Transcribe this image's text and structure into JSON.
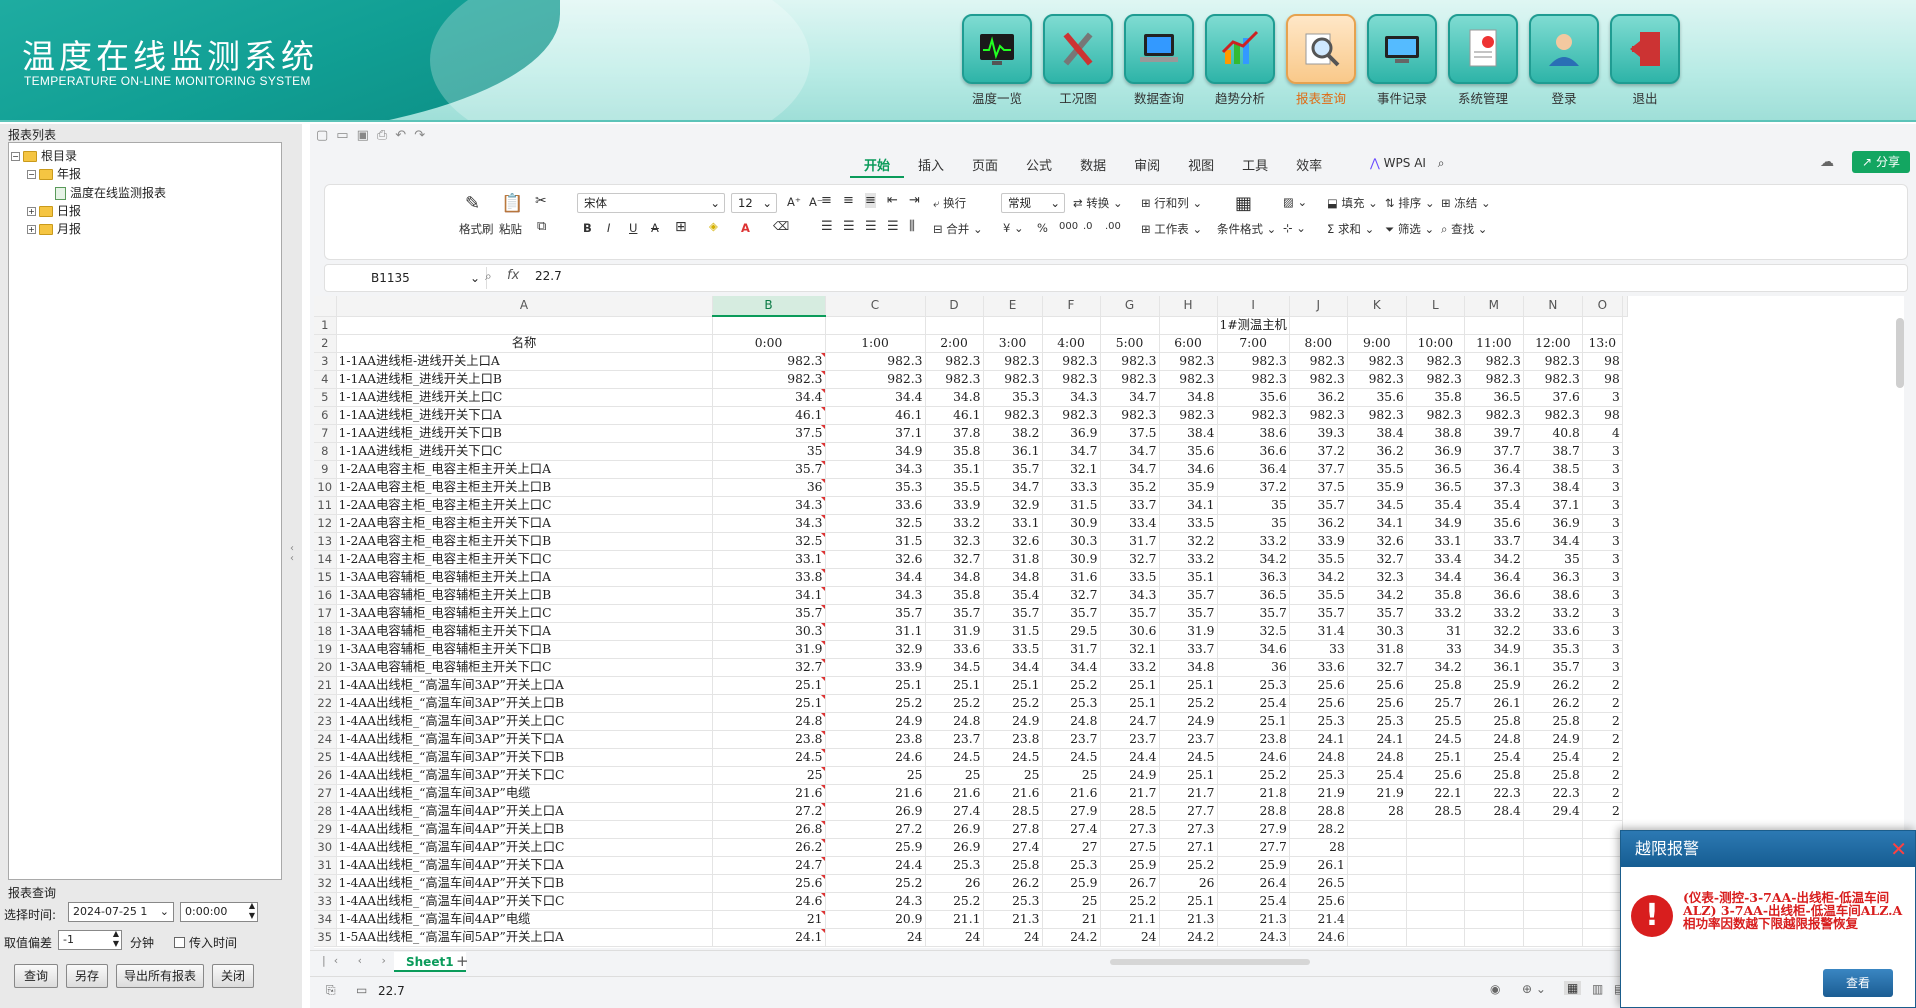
{
  "header": {
    "title": "温度在线监测系统",
    "subtitle": "TEMPERATURE ON-LINE MONITORING SYSTEM"
  },
  "nav": [
    {
      "label": "温度一览",
      "icon": "monitor-chart-icon"
    },
    {
      "label": "工况图",
      "icon": "tools-icon"
    },
    {
      "label": "数据查询",
      "icon": "laptop-icon"
    },
    {
      "label": "趋势分析",
      "icon": "trend-chart-icon"
    },
    {
      "label": "报表查询",
      "icon": "magnifier-icon",
      "active": true
    },
    {
      "label": "事件记录",
      "icon": "event-log-icon"
    },
    {
      "label": "系统管理",
      "icon": "system-doc-icon"
    },
    {
      "label": "登录",
      "icon": "user-icon"
    },
    {
      "label": "退出",
      "icon": "exit-door-icon"
    }
  ],
  "left": {
    "tree_title": "报表列表",
    "tree": [
      "根目录",
      "年报",
      "温度在线监测报表",
      "日报",
      "月报"
    ],
    "query_title": "报表查询",
    "select_time_label": "选择时间:",
    "date_value": "2024-07-25 1",
    "time_value": "0:00:00",
    "offset_label": "取值偏差",
    "offset_value": "-1",
    "minute_label": "分钟",
    "incoming_time_label": "传入时间",
    "buttons": [
      "查询",
      "另存",
      "导出所有报表",
      "关闭"
    ]
  },
  "wps": {
    "tabs": [
      "开始",
      "插入",
      "页面",
      "公式",
      "数据",
      "审阅",
      "视图",
      "工具",
      "效率"
    ],
    "ai_label": "WPS AI",
    "share_label": "分享",
    "ribbon": {
      "format_painter": "格式刷",
      "paste": "粘贴",
      "font_name": "宋体",
      "font_size": "12",
      "wrap": "换行",
      "merge": "合并",
      "number_format": "常规",
      "convert": "转换",
      "row_col": "行和列",
      "worksheet": "工作表",
      "cond_format": "条件格式",
      "fill": "填充",
      "sort": "排序",
      "freeze": "冻结",
      "sum": "求和",
      "filter": "筛选",
      "find": "查找"
    },
    "name_box": "B1135",
    "formula_value": "22.7",
    "sheet_tab": "Sheet1",
    "status_value": "22.7"
  },
  "sheet": {
    "columns": [
      "A",
      "B",
      "C",
      "D",
      "E",
      "F",
      "G",
      "H",
      "I",
      "J",
      "K",
      "L",
      "M",
      "N",
      "O"
    ],
    "row1_title": "1#测温主机",
    "name_header": "名称",
    "times": [
      "0:00",
      "1:00",
      "2:00",
      "3:00",
      "4:00",
      "5:00",
      "6:00",
      "7:00",
      "8:00",
      "9:00",
      "10:00",
      "11:00",
      "12:00",
      "13:0"
    ],
    "rows": [
      [
        "1-1AA进线柜-进线开关上口A",
        "982.3",
        "982.3",
        "982.3",
        "982.3",
        "982.3",
        "982.3",
        "982.3",
        "982.3",
        "982.3",
        "982.3",
        "982.3",
        "982.3",
        "982.3",
        "98"
      ],
      [
        "1-1AA进线柜_进线开关上口B",
        "982.3",
        "982.3",
        "982.3",
        "982.3",
        "982.3",
        "982.3",
        "982.3",
        "982.3",
        "982.3",
        "982.3",
        "982.3",
        "982.3",
        "982.3",
        "98"
      ],
      [
        "1-1AA进线柜_进线开关上口C",
        "34.4",
        "34.4",
        "34.8",
        "35.3",
        "34.3",
        "34.7",
        "34.8",
        "35.6",
        "36.2",
        "35.6",
        "35.8",
        "36.5",
        "37.6",
        "3"
      ],
      [
        "1-1AA进线柜_进线开关下口A",
        "46.1",
        "46.1",
        "46.1",
        "982.3",
        "982.3",
        "982.3",
        "982.3",
        "982.3",
        "982.3",
        "982.3",
        "982.3",
        "982.3",
        "982.3",
        "98"
      ],
      [
        "1-1AA进线柜_进线开关下口B",
        "37.5",
        "37.1",
        "37.8",
        "38.2",
        "36.9",
        "37.5",
        "38.4",
        "38.6",
        "39.3",
        "38.4",
        "38.8",
        "39.7",
        "40.8",
        "4"
      ],
      [
        "1-1AA进线柜_进线开关下口C",
        "35",
        "34.9",
        "35.8",
        "36.1",
        "34.7",
        "34.7",
        "35.6",
        "36.6",
        "37.2",
        "36.2",
        "36.9",
        "37.7",
        "38.7",
        "3"
      ],
      [
        "1-2AA电容主柜_电容主柜主开关上口A",
        "35.7",
        "34.3",
        "35.1",
        "35.7",
        "32.1",
        "34.7",
        "34.6",
        "36.4",
        "37.7",
        "35.5",
        "36.5",
        "36.4",
        "38.5",
        "3"
      ],
      [
        "1-2AA电容主柜_电容主柜主开关上口B",
        "36",
        "35.3",
        "35.5",
        "34.7",
        "33.3",
        "35.2",
        "35.9",
        "37.2",
        "37.5",
        "35.9",
        "36.5",
        "37.3",
        "38.4",
        "3"
      ],
      [
        "1-2AA电容主柜_电容主柜主开关上口C",
        "34.3",
        "33.6",
        "33.9",
        "32.9",
        "31.5",
        "33.7",
        "34.1",
        "35",
        "35.7",
        "34.5",
        "35.4",
        "35.4",
        "37.1",
        "3"
      ],
      [
        "1-2AA电容主柜_电容主柜主开关下口A",
        "34.3",
        "32.5",
        "33.2",
        "33.1",
        "30.9",
        "33.4",
        "33.5",
        "35",
        "36.2",
        "34.1",
        "34.9",
        "35.6",
        "36.9",
        "3"
      ],
      [
        "1-2AA电容主柜_电容主柜主开关下口B",
        "32.5",
        "31.5",
        "32.3",
        "32.6",
        "30.3",
        "31.7",
        "32.2",
        "33.2",
        "33.9",
        "32.6",
        "33.1",
        "33.7",
        "34.4",
        "3"
      ],
      [
        "1-2AA电容主柜_电容主柜主开关下口C",
        "33.1",
        "32.6",
        "32.7",
        "31.8",
        "30.9",
        "32.7",
        "33.2",
        "34.2",
        "35.5",
        "32.7",
        "33.4",
        "34.2",
        "35",
        "3"
      ],
      [
        "1-3AA电容辅柜_电容辅柜主开关上口A",
        "33.8",
        "34.4",
        "34.8",
        "34.8",
        "31.6",
        "33.5",
        "35.1",
        "36.3",
        "34.2",
        "32.3",
        "34.4",
        "36.4",
        "36.3",
        "3"
      ],
      [
        "1-3AA电容辅柜_电容辅柜主开关上口B",
        "34.1",
        "34.3",
        "35.8",
        "35.4",
        "32.7",
        "34.3",
        "35.7",
        "36.5",
        "35.5",
        "34.2",
        "35.8",
        "36.6",
        "38.6",
        "3"
      ],
      [
        "1-3AA电容辅柜_电容辅柜主开关上口C",
        "35.7",
        "35.7",
        "35.7",
        "35.7",
        "35.7",
        "35.7",
        "35.7",
        "35.7",
        "35.7",
        "35.7",
        "33.2",
        "33.2",
        "33.2",
        "3"
      ],
      [
        "1-3AA电容辅柜_电容辅柜主开关下口A",
        "30.3",
        "31.1",
        "31.9",
        "31.5",
        "29.5",
        "30.6",
        "31.9",
        "32.5",
        "31.4",
        "30.3",
        "31",
        "32.2",
        "33.6",
        "3"
      ],
      [
        "1-3AA电容辅柜_电容辅柜主开关下口B",
        "31.9",
        "32.9",
        "33.6",
        "33.5",
        "31.7",
        "32.1",
        "33.7",
        "34.6",
        "33",
        "31.8",
        "33",
        "34.9",
        "35.3",
        "3"
      ],
      [
        "1-3AA电容辅柜_电容辅柜主开关下口C",
        "32.7",
        "33.9",
        "34.5",
        "34.4",
        "34.4",
        "33.2",
        "34.8",
        "36",
        "33.6",
        "32.7",
        "34.2",
        "36.1",
        "35.7",
        "3"
      ],
      [
        "1-4AA出线柜_“高温车间3AP”开关上口A",
        "25.1",
        "25.1",
        "25.1",
        "25.1",
        "25.2",
        "25.1",
        "25.1",
        "25.3",
        "25.6",
        "25.6",
        "25.8",
        "25.9",
        "26.2",
        "2"
      ],
      [
        "1-4AA出线柜_“高温车间3AP”开关上口B",
        "25.1",
        "25.2",
        "25.2",
        "25.2",
        "25.3",
        "25.1",
        "25.2",
        "25.4",
        "25.6",
        "25.6",
        "25.7",
        "26.1",
        "26.2",
        "2"
      ],
      [
        "1-4AA出线柜_“高温车间3AP”开关上口C",
        "24.8",
        "24.9",
        "24.8",
        "24.9",
        "24.8",
        "24.7",
        "24.9",
        "25.1",
        "25.3",
        "25.3",
        "25.5",
        "25.8",
        "25.8",
        "2"
      ],
      [
        "1-4AA出线柜_“高温车间3AP”开关下口A",
        "23.8",
        "23.8",
        "23.7",
        "23.8",
        "23.7",
        "23.7",
        "23.7",
        "23.8",
        "24.1",
        "24.1",
        "24.5",
        "24.8",
        "24.9",
        "2"
      ],
      [
        "1-4AA出线柜_“高温车间3AP”开关下口B",
        "24.5",
        "24.6",
        "24.5",
        "24.5",
        "24.5",
        "24.4",
        "24.5",
        "24.6",
        "24.8",
        "24.8",
        "25.1",
        "25.4",
        "25.4",
        "2"
      ],
      [
        "1-4AA出线柜_“高温车间3AP”开关下口C",
        "25",
        "25",
        "25",
        "25",
        "25",
        "24.9",
        "25.1",
        "25.2",
        "25.3",
        "25.4",
        "25.6",
        "25.8",
        "25.8",
        "2"
      ],
      [
        "1-4AA出线柜_“高温车间3AP”电缆",
        "21.6",
        "21.6",
        "21.6",
        "21.6",
        "21.6",
        "21.7",
        "21.7",
        "21.8",
        "21.9",
        "21.9",
        "22.1",
        "22.3",
        "22.3",
        "2"
      ],
      [
        "1-4AA出线柜_“高温车间4AP”开关上口A",
        "27.2",
        "26.9",
        "27.4",
        "28.5",
        "27.9",
        "28.5",
        "27.7",
        "28.8",
        "28.8",
        "28",
        "28.5",
        "28.4",
        "29.4",
        "2"
      ],
      [
        "1-4AA出线柜_“高温车间4AP”开关上口B",
        "26.8",
        "27.2",
        "26.9",
        "27.8",
        "27.4",
        "27.3",
        "27.3",
        "27.9",
        "28.2",
        "",
        "",
        "",
        "",
        ""
      ],
      [
        "1-4AA出线柜_“高温车间4AP”开关上口C",
        "26.2",
        "25.9",
        "26.9",
        "27.4",
        "27",
        "27.5",
        "27.1",
        "27.7",
        "28",
        "",
        "",
        "",
        "",
        ""
      ],
      [
        "1-4AA出线柜_“高温车间4AP”开关下口A",
        "24.7",
        "24.4",
        "25.3",
        "25.8",
        "25.3",
        "25.9",
        "25.2",
        "25.9",
        "26.1",
        "",
        "",
        "",
        "",
        ""
      ],
      [
        "1-4AA出线柜_“高温车间4AP”开关下口B",
        "25.6",
        "25.2",
        "26",
        "26.2",
        "25.9",
        "26.7",
        "26",
        "26.4",
        "26.5",
        "",
        "",
        "",
        "",
        ""
      ],
      [
        "1-4AA出线柜_“高温车间4AP”开关下口C",
        "24.6",
        "24.3",
        "25.2",
        "25.3",
        "25",
        "25.2",
        "25.1",
        "25.4",
        "25.6",
        "",
        "",
        "",
        "",
        ""
      ],
      [
        "1-4AA出线柜_“高温车间4AP”电缆",
        "21",
        "20.9",
        "21.1",
        "21.3",
        "21",
        "21.1",
        "21.3",
        "21.3",
        "21.4",
        "",
        "",
        "",
        "",
        ""
      ],
      [
        "1-5AA出线柜_“高温车间5AP”开关上口A",
        "24.1",
        "24",
        "24",
        "24",
        "24.2",
        "24",
        "24.2",
        "24.3",
        "24.6",
        "",
        "",
        "",
        "",
        ""
      ]
    ]
  },
  "alert": {
    "title": "越限报警",
    "message": "(仪表-测控-3-7AA-出线柜-低温车间ALZ) 3-7AA-出线柜-低温车间ALZ.A相功率因数越下限越限报警恢复",
    "button": "查看"
  }
}
